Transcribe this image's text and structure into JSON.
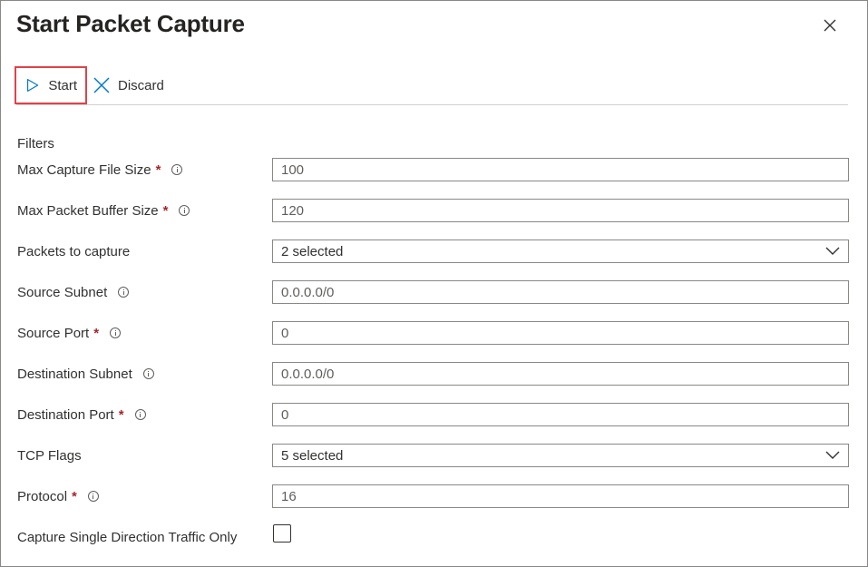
{
  "header": {
    "title": "Start Packet Capture"
  },
  "toolbar": {
    "start_label": "Start",
    "discard_label": "Discard"
  },
  "section": {
    "label": "Filters"
  },
  "fields": [
    {
      "label": "Max Capture File Size",
      "required": "*",
      "value": "100"
    },
    {
      "label": "Max Packet Buffer Size",
      "required": "*",
      "value": "120"
    },
    {
      "label": "Packets to capture",
      "value": "2 selected"
    },
    {
      "label": "Source Subnet",
      "value": "0.0.0.0/0"
    },
    {
      "label": "Source Port",
      "required": "*",
      "value": "0"
    },
    {
      "label": "Destination Subnet",
      "value": "0.0.0.0/0"
    },
    {
      "label": "Destination Port",
      "required": "*",
      "value": "0"
    },
    {
      "label": "TCP Flags",
      "value": "5 selected"
    },
    {
      "label": "Protocol",
      "required": "*",
      "value": "16"
    },
    {
      "label": "Capture Single Direction Traffic Only"
    }
  ],
  "colors": {
    "accent": "#0078d4",
    "highlight": "#e0424b",
    "required": "#a4262c"
  }
}
